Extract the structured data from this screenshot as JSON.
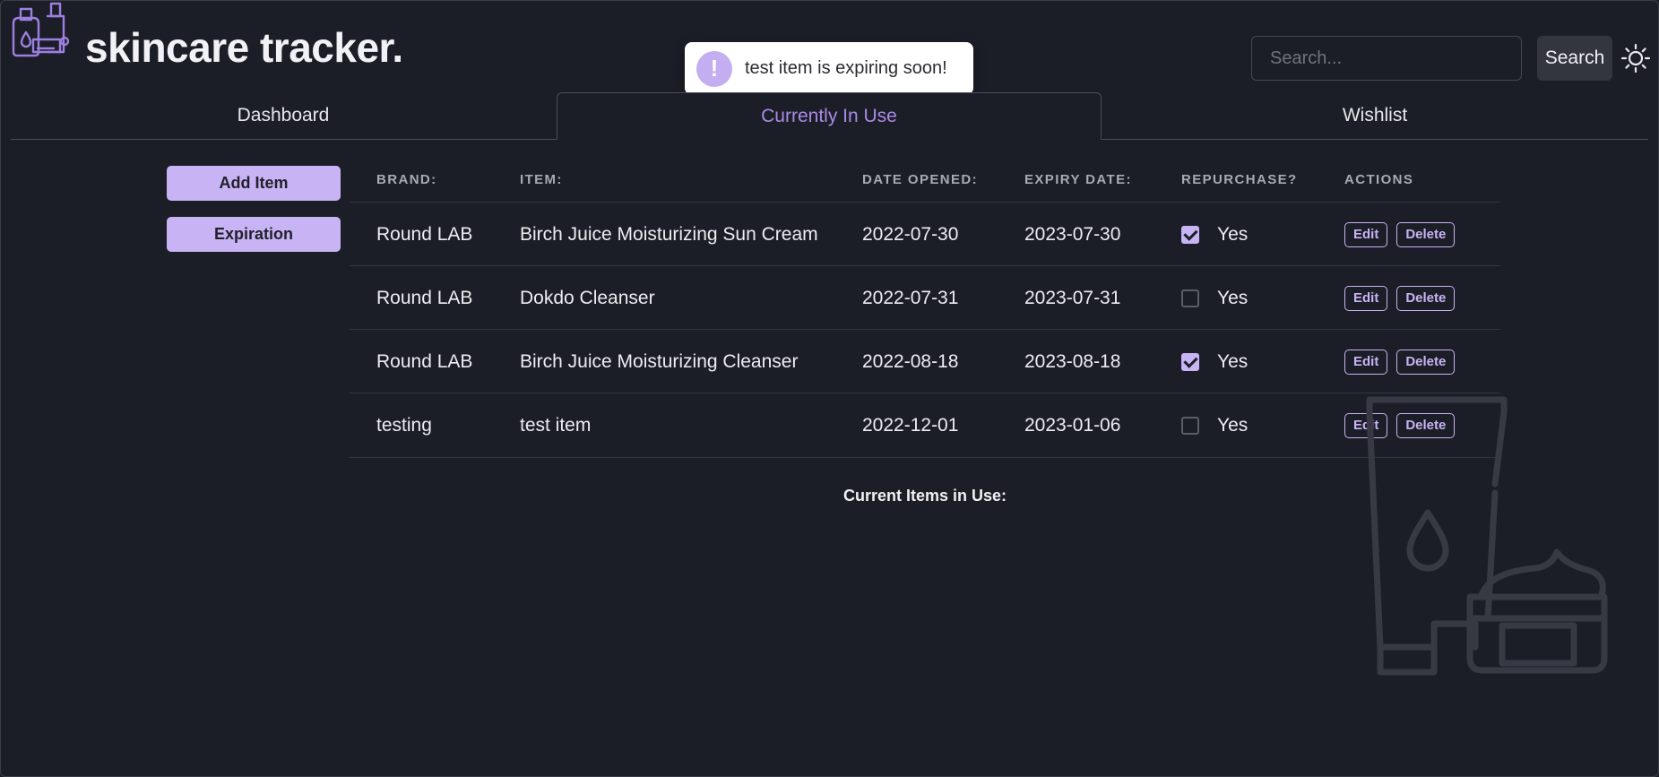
{
  "app": {
    "title": "skincare tracker."
  },
  "header": {
    "search_placeholder": "Search...",
    "search_label": "Search"
  },
  "toast": {
    "icon": "!",
    "message": "test item is expiring soon!"
  },
  "tabs": [
    {
      "label": "Dashboard",
      "active": false
    },
    {
      "label": "Currently In Use",
      "active": true
    },
    {
      "label": "Wishlist",
      "active": false
    }
  ],
  "sidebar": {
    "add_item_label": "Add Item",
    "expiration_label": "Expiration"
  },
  "table": {
    "headers": {
      "brand": "BRAND:",
      "item": "ITEM:",
      "date_opened": "DATE OPENED:",
      "expiry_date": "EXPIRY DATE:",
      "repurchase": "REPURCHASE?",
      "actions": "ACTIONS"
    },
    "rows": [
      {
        "brand": "Round LAB",
        "item": "Birch Juice Moisturizing Sun Cream",
        "date_opened": "2022-07-30",
        "expiry_date": "2023-07-30",
        "repurchase_checked": true,
        "repurchase_label": "Yes",
        "edit": "Edit",
        "delete": "Delete"
      },
      {
        "brand": "Round LAB",
        "item": "Dokdo Cleanser",
        "date_opened": "2022-07-31",
        "expiry_date": "2023-07-31",
        "repurchase_checked": false,
        "repurchase_label": "Yes",
        "edit": "Edit",
        "delete": "Delete"
      },
      {
        "brand": "Round LAB",
        "item": "Birch Juice Moisturizing Cleanser",
        "date_opened": "2022-08-18",
        "expiry_date": "2023-08-18",
        "repurchase_checked": true,
        "repurchase_label": "Yes",
        "edit": "Edit",
        "delete": "Delete"
      },
      {
        "brand": "testing",
        "item": "test item",
        "date_opened": "2022-12-01",
        "expiry_date": "2023-01-06",
        "repurchase_checked": false,
        "repurchase_label": "Yes",
        "edit": "Edit",
        "delete": "Delete"
      }
    ],
    "footer": "Current Items in Use:"
  },
  "colors": {
    "background": "#1c1e27",
    "accent": "#c8b3f5",
    "accent_text": "#a98ae6"
  },
  "icons": {
    "logo": "skincare-bottles-logo-icon",
    "theme": "sun-icon",
    "illustration": "tube-and-jar-illustration"
  }
}
